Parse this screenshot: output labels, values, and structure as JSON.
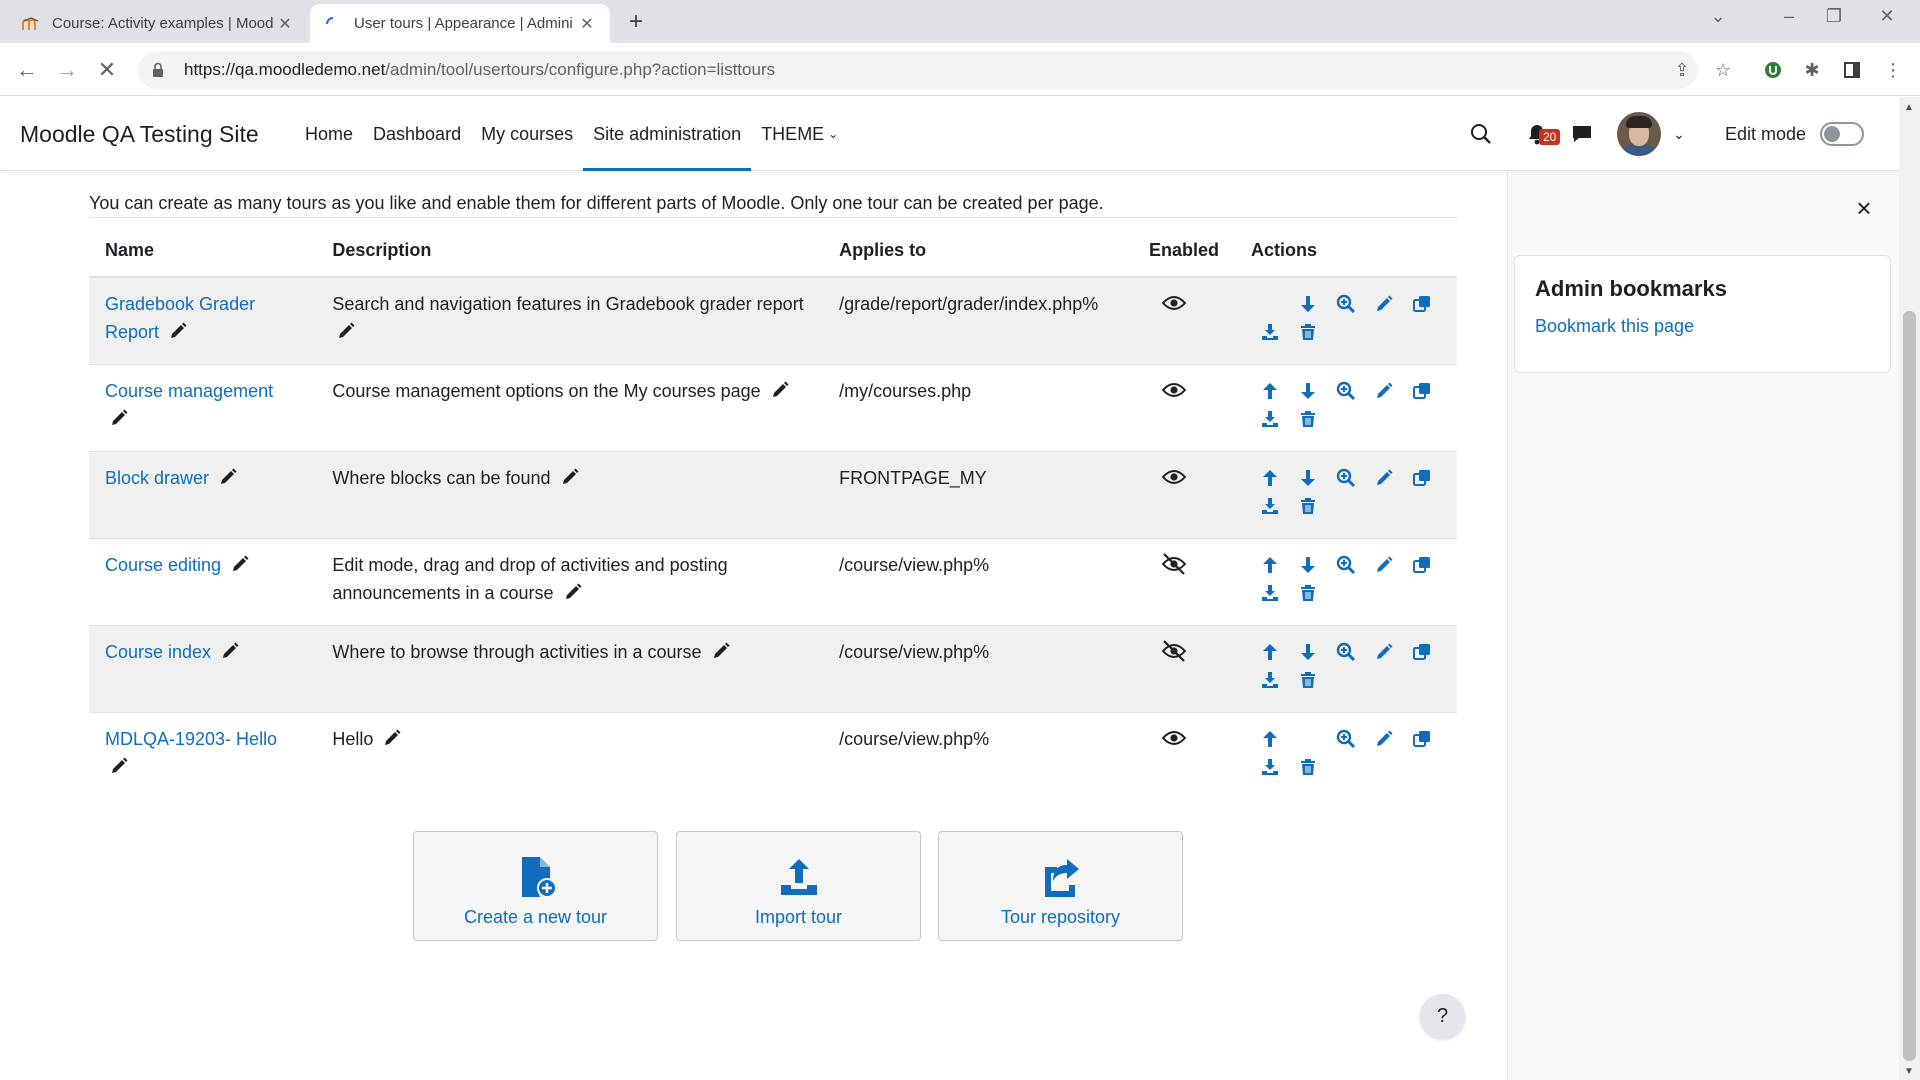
{
  "browser": {
    "tabs": [
      {
        "title": "Course: Activity examples | Mood",
        "active": false
      },
      {
        "title": "User tours | Appearance | Admini",
        "active": true
      }
    ],
    "url_host": "https://qa.moodledemo.net",
    "url_path": "/admin/tool/usertours/configure.php?action=listtours"
  },
  "navbar": {
    "site_name": "Moodle QA Testing Site",
    "items": [
      {
        "label": "Home",
        "active": false
      },
      {
        "label": "Dashboard",
        "active": false
      },
      {
        "label": "My courses",
        "active": false
      },
      {
        "label": "Site administration",
        "active": true
      },
      {
        "label": "THEME",
        "active": false
      }
    ],
    "notification_count": "20",
    "edit_mode_label": "Edit mode",
    "edit_mode_on": false
  },
  "page": {
    "intro": "You can create as many tours as you like and enable them for different parts of Moodle. Only one tour can be created per page."
  },
  "table": {
    "headers": {
      "name": "Name",
      "description": "Description",
      "applies_to": "Applies to",
      "enabled": "Enabled",
      "actions": "Actions"
    },
    "rows": [
      {
        "name": "Gradebook Grader Report",
        "description": "Search and navigation features in Gradebook grader report",
        "applies_to": "/grade/report/grader/index.php%",
        "enabled": true,
        "move_up": false,
        "move_down": true
      },
      {
        "name": "Course management",
        "description": "Course management options on the My courses page",
        "applies_to": "/my/courses.php",
        "enabled": true,
        "move_up": true,
        "move_down": true
      },
      {
        "name": "Block drawer",
        "description": "Where blocks can be found",
        "applies_to": "FRONTPAGE_MY",
        "enabled": true,
        "move_up": true,
        "move_down": true
      },
      {
        "name": "Course editing",
        "description": "Edit mode, drag and drop of activities and posting announcements in a course",
        "applies_to": "/course/view.php%",
        "enabled": false,
        "move_up": true,
        "move_down": true
      },
      {
        "name": "Course index",
        "description": "Where to browse through activities in a course",
        "applies_to": "/course/view.php%",
        "enabled": false,
        "move_up": true,
        "move_down": true
      },
      {
        "name": "MDLQA-19203- Hello",
        "description": "Hello",
        "applies_to": "/course/view.php%",
        "enabled": true,
        "move_up": true,
        "move_down": false
      }
    ]
  },
  "buttons": {
    "create": "Create a new tour",
    "import": "Import tour",
    "repository": "Tour repository"
  },
  "drawer": {
    "block_title": "Admin bookmarks",
    "bookmark_link": "Bookmark this page"
  },
  "help": {
    "label": "?"
  },
  "colors": {
    "accent": "#0f6cbf",
    "badge": "#ca3120"
  }
}
